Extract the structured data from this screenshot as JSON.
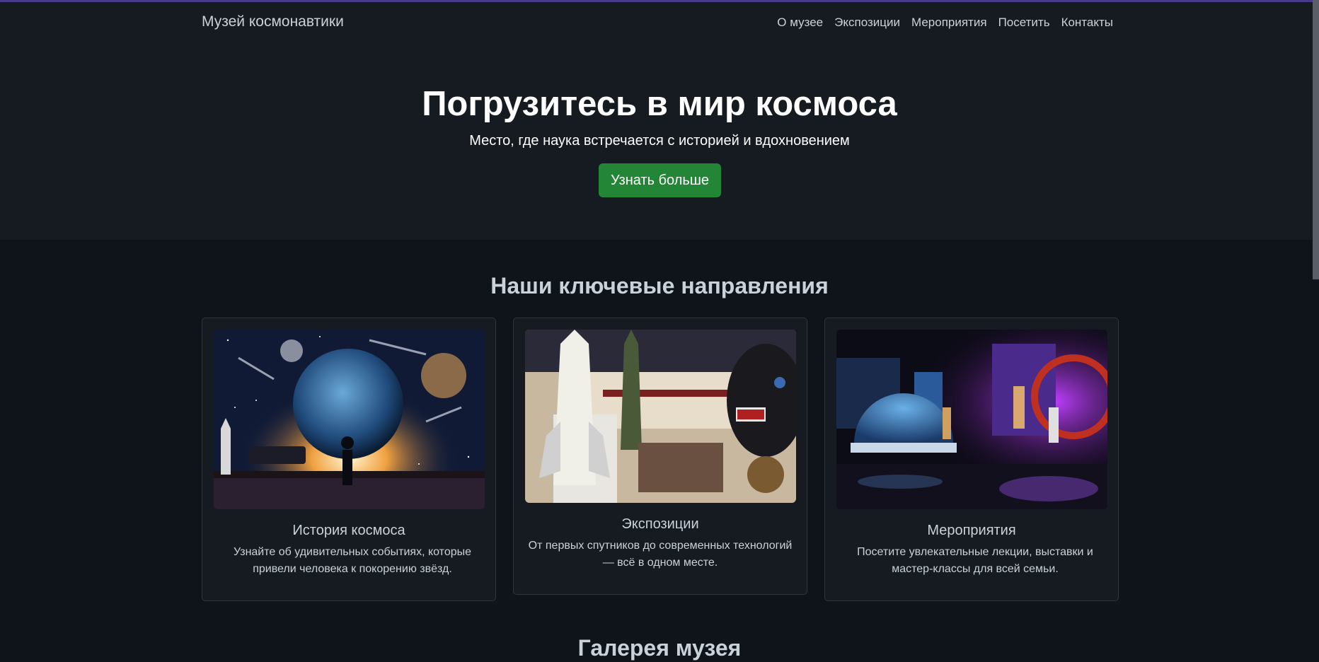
{
  "header": {
    "brand": "Музей космонавтики",
    "nav": [
      "О музее",
      "Экспозиции",
      "Мероприятия",
      "Посетить",
      "Контакты"
    ]
  },
  "hero": {
    "title": "Погрузитесь в мир космоса",
    "subtitle": "Место, где наука встречается с историей и вдохновением",
    "button": "Узнать больше"
  },
  "directions": {
    "title": "Наши ключевые направления",
    "cards": [
      {
        "title": "История космоса",
        "text": "Узнайте об удивительных событиях, которые привели человека к покорению звёзд."
      },
      {
        "title": "Экспозиции",
        "text": "От первых спутников до современных технологий — всё в одном месте."
      },
      {
        "title": "Мероприятия",
        "text": "Посетите увлекательные лекции, выставки и мастер-классы для всей семьи."
      }
    ]
  },
  "gallery": {
    "title": "Галерея музея"
  },
  "colors": {
    "accent": "#238636",
    "background": "#0f141b",
    "panel": "#161b22"
  }
}
